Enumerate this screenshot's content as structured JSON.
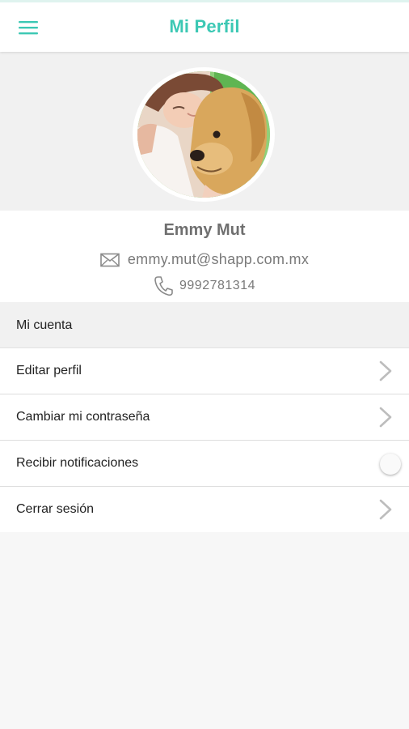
{
  "header": {
    "title": "Mi Perfil",
    "menu_icon": "hamburger-menu-icon",
    "accent_color": "#3cc8b4"
  },
  "profile": {
    "name": "Emmy Mut",
    "email": "emmy.mut@shapp.com.mx",
    "phone": "9992781314",
    "email_icon": "envelope-icon",
    "phone_icon": "phone-icon"
  },
  "account": {
    "section_title": "Mi cuenta",
    "items": [
      {
        "label": "Editar perfil",
        "control": "chevron"
      },
      {
        "label": "Cambiar mi contraseña",
        "control": "chevron"
      },
      {
        "label": "Recibir notificaciones",
        "control": "toggle",
        "toggle_on": false
      },
      {
        "label": "Cerrar sesión",
        "control": "chevron"
      }
    ]
  }
}
